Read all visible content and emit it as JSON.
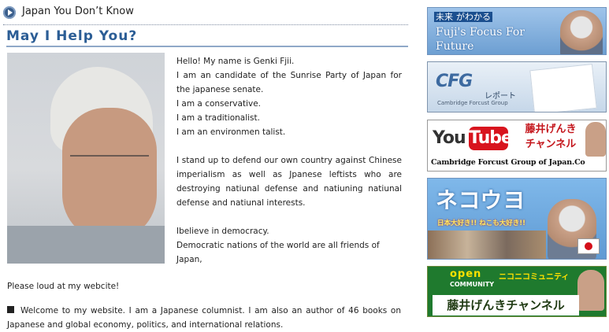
{
  "header": {
    "section_title": "Japan You Don’t Know"
  },
  "page": {
    "title": "May I Help You?"
  },
  "bio": {
    "lines": [
      "Hello! My name is Genki Fjii.",
      "I am an candidate of the Sunrise Party of Japan for the japanese senate.",
      "I am a conservative.",
      "I am a traditionalist.",
      "I am an environmen talist."
    ],
    "stand_up": "I stand up to defend our own country against Chinese imperialism as well as Jpanese  leftists who are destroying natiunal defense and natiuning natiunal defense and natiunal interests.",
    "democracy_1": "Ibelieve in democracy.",
    "democracy_2": "Democratic nations of the world are all friends of Japan,"
  },
  "loud": "Please loud at my webcite!",
  "welcome": "Welcome to my website. I am a Japanese columnist. I am also an author of 46 books on Japanese and global economy, politics, and international relations.",
  "banners": {
    "future": {
      "tag_highlight": "未来",
      "tag_rest": "がわかる",
      "title": "Fuji's Focus For Future"
    },
    "cfg": {
      "logo": "CFG",
      "label": "レポート",
      "sub": "Cambridge Forcust Group"
    },
    "youtube": {
      "you": "You",
      "tube": "Tube",
      "jp_line1": "藤井げんき",
      "jp_line2": "チャンネル",
      "caption": "Cambridge Forcust Group of Japan.Co"
    },
    "nekouyo": {
      "title": "ネコウヨ",
      "subtitle": "日本大好き!! ねこも大好き!!"
    },
    "open": {
      "open": "open",
      "community": "COMMUNITY",
      "nico": "ニコニコミュニティ",
      "name": "藤井げんきチャンネル"
    }
  }
}
